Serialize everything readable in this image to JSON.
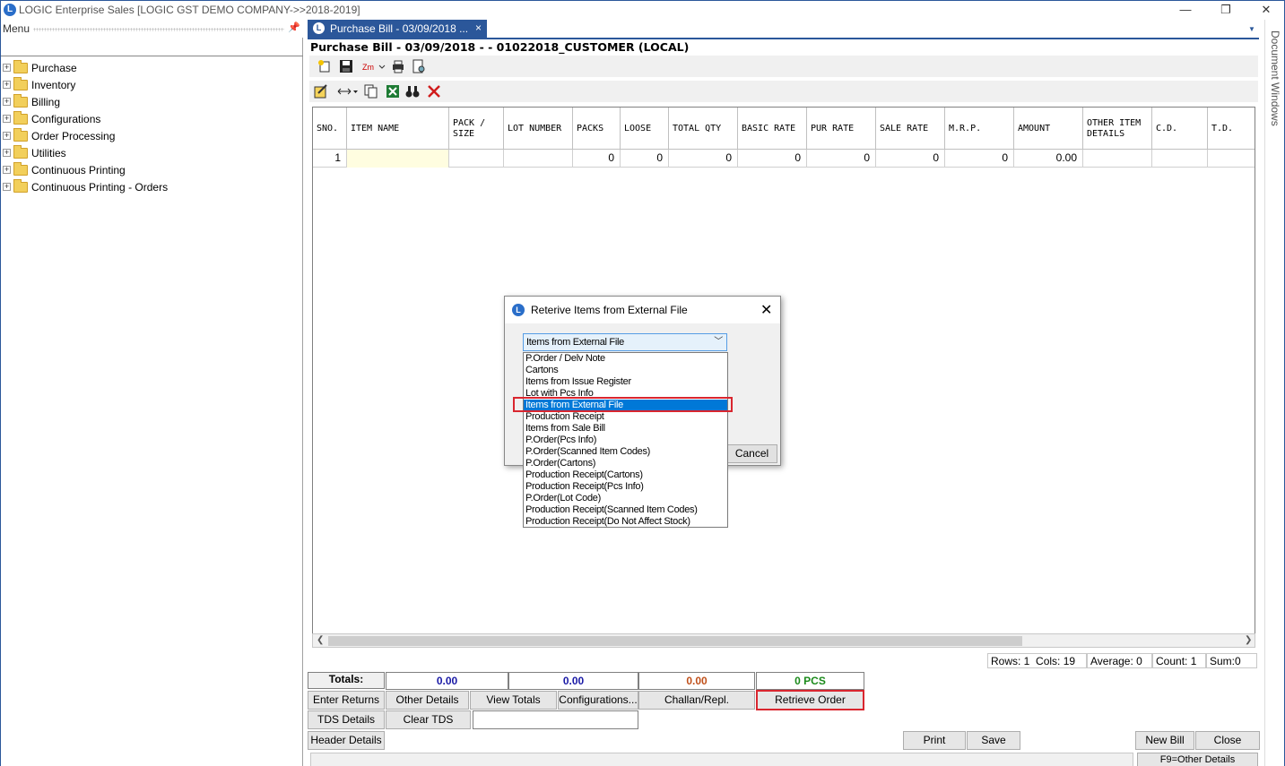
{
  "window": {
    "title": "LOGIC Enterprise Sales  [LOGIC GST DEMO COMPANY->>2018-2019]",
    "minimize": "—",
    "restore": "❐",
    "close": "✕"
  },
  "menu": {
    "header": "Menu",
    "pin_icon": "pin-icon",
    "items": [
      {
        "label": "Purchase"
      },
      {
        "label": "Inventory"
      },
      {
        "label": "Billing"
      },
      {
        "label": "Configurations"
      },
      {
        "label": "Order Processing"
      },
      {
        "label": "Utilities"
      },
      {
        "label": "Continuous Printing"
      },
      {
        "label": "Continuous Printing - Orders"
      }
    ]
  },
  "tab": {
    "label": "Purchase Bill - 03/09/2018 ...",
    "close": "×"
  },
  "doc": {
    "title": "Purchase Bill - 03/09/2018 -  - 01022018_CUSTOMER (LOCAL)"
  },
  "grid": {
    "columns": [
      "SNO.",
      "ITEM NAME",
      "PACK / SIZE",
      "LOT NUMBER",
      "PACKS",
      "LOOSE",
      "TOTAL QTY",
      "BASIC RATE",
      "PUR RATE",
      "SALE RATE",
      "M.R.P.",
      "AMOUNT",
      "OTHER ITEM DETAILS",
      "C.D.",
      "T.D."
    ],
    "rows": [
      [
        "1",
        "",
        "",
        "",
        "0",
        "0",
        "0",
        "0",
        "0",
        "0",
        "0",
        "0.00",
        "",
        "",
        ""
      ]
    ]
  },
  "status": {
    "rows": "Rows: 1",
    "cols": "Cols: 19",
    "average": "Average: 0",
    "count": "Count: 1",
    "sum": "Sum:0"
  },
  "totals": {
    "label": "Totals:",
    "v1": "0.00",
    "v2": "0.00",
    "v3": "0.00",
    "v4": "0 PCS"
  },
  "buttons": {
    "enter_returns": "Enter Returns",
    "other_details": "Other Details",
    "view_totals": "View Totals",
    "configurations": "Configurations...",
    "challan": "Challan/Repl.",
    "retrieve_order": "Retrieve Order",
    "tds_details": "TDS Details",
    "clear_tds": "Clear TDS",
    "header_details": "Header Details",
    "print": "Print",
    "save": "Save",
    "new_bill": "New Bill",
    "close": "Close",
    "f9": "F9=Other Details"
  },
  "side_panel": {
    "label": "Document Windows"
  },
  "dialog": {
    "title": "Reterive Items from External File",
    "close": "✕",
    "selected": "Items from External File",
    "cancel": "Cancel",
    "options": [
      "P.Order / Delv Note",
      "Cartons",
      "Items from Issue Register",
      "Lot with Pcs Info",
      "Items from External File",
      "Production Receipt",
      "Items from Sale Bill",
      "P.Order(Pcs Info)",
      "P.Order(Scanned Item Codes)",
      "P.Order(Cartons)",
      "Production Receipt(Cartons)",
      "Production Receipt(Pcs Info)",
      "P.Order(Lot Code)",
      "Production Receipt(Scanned Item Codes)",
      "Production Receipt(Do Not Affect Stock)"
    ],
    "selected_index": 4
  },
  "colors": {
    "accent": "#2b579a",
    "highlight": "#d9262f",
    "total_blue": "#1a1aa6",
    "total_orange": "#c0501a",
    "total_green": "#1a8a1a"
  }
}
